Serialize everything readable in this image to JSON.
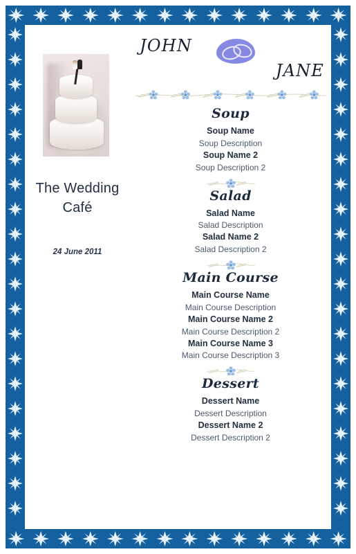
{
  "document": {
    "type": "wedding-menu-template",
    "border_color": "#15609f",
    "accent_color": "#7b7fe0",
    "heading_color": "#1b2b3d",
    "body_color": "#4a5a6b"
  },
  "left_panel": {
    "photo_alt": "wedding-cake-photo",
    "venue_name": "The Wedding Café",
    "event_date": "24 June 2011"
  },
  "header": {
    "name_first": "JOHN",
    "name_second": "JANE",
    "emblem": "wedding-rings-icon"
  },
  "menu": {
    "sections": [
      {
        "title": "Soup",
        "items": [
          {
            "name": "Soup Name",
            "description": "Soup Description"
          },
          {
            "name": "Soup Name 2",
            "description": "Soup Description 2"
          }
        ]
      },
      {
        "title": "Salad",
        "items": [
          {
            "name": "Salad Name",
            "description": "Salad Description"
          },
          {
            "name": "Salad Name 2",
            "description": "Salad Description 2"
          }
        ]
      },
      {
        "title": "Main Course",
        "items": [
          {
            "name": "Main Course Name",
            "description": "Main Course Description"
          },
          {
            "name": "Main Course Name 2",
            "description": "Main Course Description 2"
          },
          {
            "name": "Main Course Name 3",
            "description": "Main Course Description 3"
          }
        ]
      },
      {
        "title": "Dessert",
        "items": [
          {
            "name": "Dessert Name",
            "description": "Dessert Description"
          },
          {
            "name": "Dessert Name 2",
            "description": "Dessert Description 2"
          }
        ]
      }
    ]
  }
}
